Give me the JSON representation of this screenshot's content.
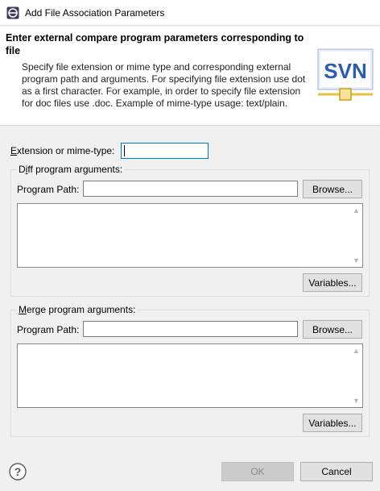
{
  "window": {
    "title": "Add File Association Parameters"
  },
  "header": {
    "title": "Enter external compare program parameters corresponding to file",
    "description": "Specify file extension or mime type and corresponding external program path and arguments. For specifying file extension use dot as a first character. For example, in order to specify file extension for doc files use .doc. Example of mime-type usage: text/plain.",
    "logo_text": "SVN"
  },
  "extension": {
    "label_mnemonic": "E",
    "label_rest": "xtension or mime-type:",
    "value": ""
  },
  "diff_group": {
    "legend_pre": "D",
    "legend_mnemonic": "i",
    "legend_rest": "ff program arguments:",
    "program_path_label": "Program Path:",
    "program_path_value": "",
    "browse_label": "Browse...",
    "arguments_value": "",
    "variables_label": "Variables..."
  },
  "merge_group": {
    "legend_mnemonic": "M",
    "legend_rest": "erge program arguments:",
    "program_path_label": "Program Path:",
    "program_path_value": "",
    "browse_label": "Browse...",
    "arguments_value": "",
    "variables_label": "Variables..."
  },
  "footer": {
    "ok_label": "OK",
    "cancel_label": "Cancel",
    "help_glyph": "?"
  },
  "colors": {
    "focus_border": "#0078d7",
    "svn_blue": "#2a5db0",
    "svn_gold": "#e8c23a"
  }
}
